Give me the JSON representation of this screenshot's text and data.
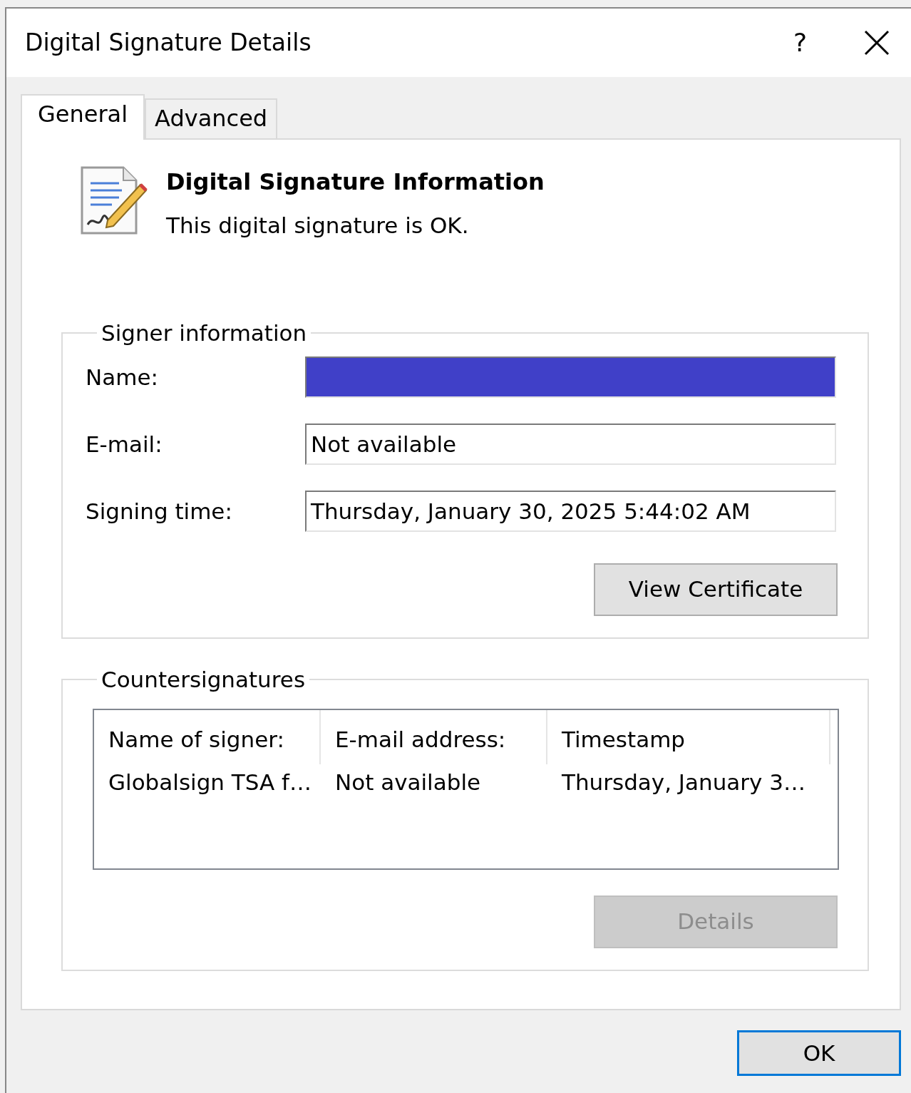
{
  "window": {
    "title": "Digital Signature Details",
    "help": "?"
  },
  "tabs": [
    {
      "label": "General",
      "selected": true
    },
    {
      "label": "Advanced",
      "selected": false
    }
  ],
  "header": {
    "title": "Digital Signature Information",
    "status": "This digital signature is OK."
  },
  "signer_information": {
    "title": "Signer information",
    "fields": [
      {
        "label": "Name:",
        "redacted": true
      },
      {
        "label": "E-mail:",
        "value": "Not available",
        "redacted": false
      },
      {
        "label": "Signing time:",
        "value": "Thursday, January 30, 2025 5:44:02 AM",
        "redacted": false
      }
    ],
    "button": {
      "label": "View Certificate",
      "disabled": false
    }
  },
  "countersignatures": {
    "title": "Countersignatures",
    "columns": [
      "Name of signer:",
      "E-mail address:",
      "Timestamp"
    ],
    "rows": [
      {
        "cells": [
          "Globalsign TSA f…",
          "Not available",
          "Thursday, January 3…"
        ]
      }
    ],
    "button": {
      "label": "Details",
      "disabled": true
    }
  },
  "buttons": [
    {
      "label": "OK",
      "default": true
    }
  ]
}
